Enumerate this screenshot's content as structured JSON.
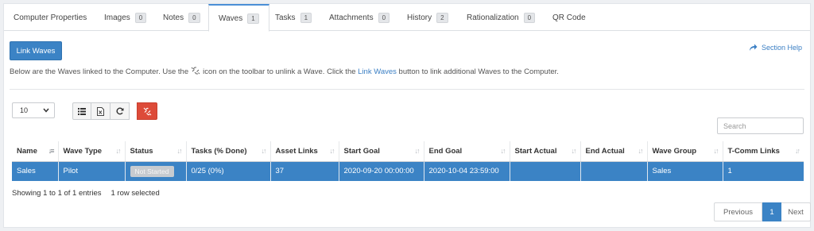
{
  "tabs": [
    {
      "label": "Computer Properties",
      "badge": ""
    },
    {
      "label": "Images",
      "badge": "0"
    },
    {
      "label": "Notes",
      "badge": "0"
    },
    {
      "label": "Waves",
      "badge": "1"
    },
    {
      "label": "Tasks",
      "badge": "1"
    },
    {
      "label": "Attachments",
      "badge": "0"
    },
    {
      "label": "History",
      "badge": "2"
    },
    {
      "label": "Rationalization",
      "badge": "0"
    },
    {
      "label": "QR Code",
      "badge": ""
    }
  ],
  "active_tab": "Waves",
  "link_waves_button": "Link Waves",
  "section_help": "Section Help",
  "description": {
    "part1": "Below are the Waves linked to the Computer. Use the",
    "part2": "icon on the toolbar to unlink a Wave. Click the",
    "link": "Link Waves",
    "part3": "button to link additional Waves to the Computer."
  },
  "page_length": "10",
  "search_placeholder": "Search",
  "table": {
    "headers": [
      "Name",
      "Wave Type",
      "Status",
      "Tasks (% Done)",
      "Asset Links",
      "Start Goal",
      "End Goal",
      "Start Actual",
      "End Actual",
      "Wave Group",
      "T-Comm Links"
    ],
    "rows": [
      {
        "name": "Sales",
        "wave_type": "Pilot",
        "status": "Not Started",
        "tasks": "0/25 (0%)",
        "asset_links": "37",
        "start_goal": "2020-09-20 00:00:00",
        "end_goal": "2020-10-04 23:59:00",
        "start_actual": "",
        "end_actual": "",
        "wave_group": "Sales",
        "tcomm_links": "1"
      }
    ]
  },
  "info": {
    "entries": "Showing 1 to 1 of 1 entries",
    "selected": "1 row selected"
  },
  "pagination": {
    "previous": "Previous",
    "current": "1",
    "next": "Next"
  },
  "colors": {
    "primary": "#3b83c5",
    "danger": "#dd4b39"
  }
}
